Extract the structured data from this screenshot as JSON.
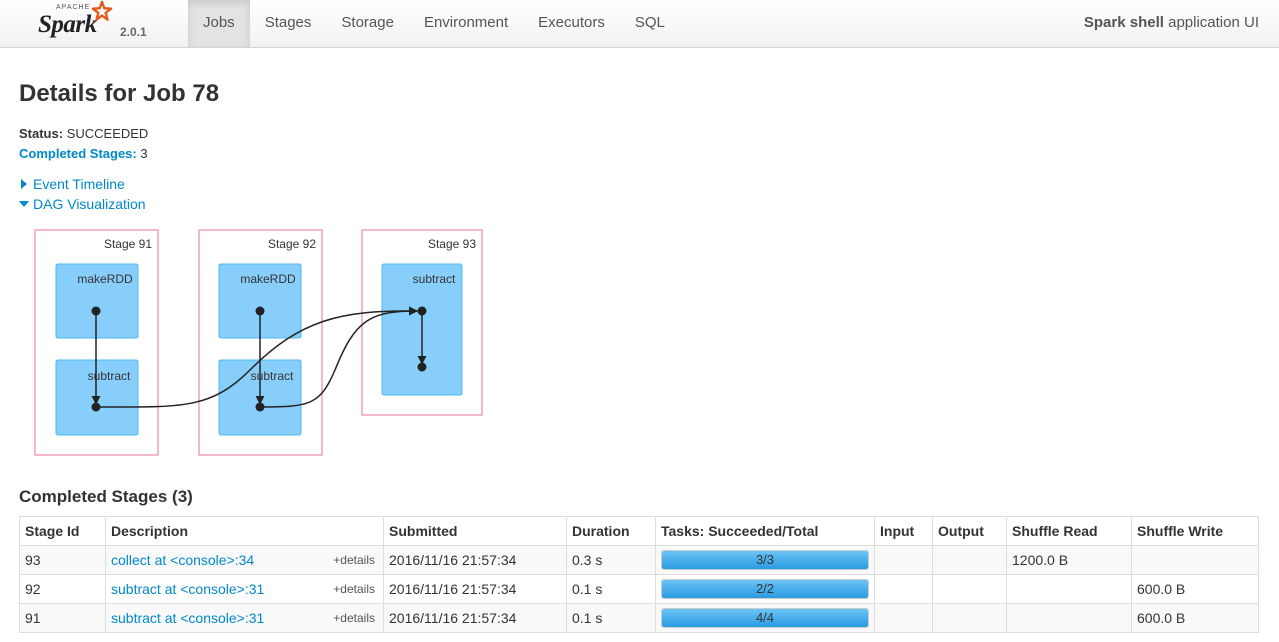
{
  "brand": {
    "apache": "APACHE",
    "name": "Spark",
    "version": "2.0.1"
  },
  "nav": {
    "tabs": [
      {
        "label": "Jobs",
        "active": true
      },
      {
        "label": "Stages",
        "active": false
      },
      {
        "label": "Storage",
        "active": false
      },
      {
        "label": "Environment",
        "active": false
      },
      {
        "label": "Executors",
        "active": false
      },
      {
        "label": "SQL",
        "active": false
      }
    ],
    "app_name": "Spark shell",
    "app_suffix": " application UI"
  },
  "page": {
    "title": "Details for Job 78",
    "status_label": "Status:",
    "status_value": "SUCCEEDED",
    "completed_label": "Completed Stages:",
    "completed_value": "3",
    "event_timeline": "Event Timeline",
    "dag_visualization": "DAG Visualization"
  },
  "dag": {
    "stages": [
      {
        "label": "Stage 91",
        "nodes": [
          "makeRDD",
          "subtract"
        ]
      },
      {
        "label": "Stage 92",
        "nodes": [
          "makeRDD",
          "subtract"
        ]
      },
      {
        "label": "Stage 93",
        "nodes": [
          "subtract"
        ]
      }
    ],
    "colors": {
      "stage_border": "#e8769a",
      "node_fill": "#87cefa",
      "node_border": "#4db8f0",
      "edge": "#222222"
    }
  },
  "completed_stages": {
    "title": "Completed Stages (3)",
    "columns": [
      "Stage Id",
      "Description",
      "Submitted",
      "Duration",
      "Tasks: Succeeded/Total",
      "Input",
      "Output",
      "Shuffle Read",
      "Shuffle Write"
    ],
    "details_label": "+details",
    "rows": [
      {
        "id": "93",
        "description": "collect at <console>:34",
        "submitted": "2016/11/16 21:57:34",
        "duration": "0.3 s",
        "tasks": "3/3",
        "progress": 1.0,
        "input": "",
        "output": "",
        "shuffle_read": "1200.0 B",
        "shuffle_write": ""
      },
      {
        "id": "92",
        "description": "subtract at <console>:31",
        "submitted": "2016/11/16 21:57:34",
        "duration": "0.1 s",
        "tasks": "2/2",
        "progress": 1.0,
        "input": "",
        "output": "",
        "shuffle_read": "",
        "shuffle_write": "600.0 B"
      },
      {
        "id": "91",
        "description": "subtract at <console>:31",
        "submitted": "2016/11/16 21:57:34",
        "duration": "0.1 s",
        "tasks": "4/4",
        "progress": 1.0,
        "input": "",
        "output": "",
        "shuffle_read": "",
        "shuffle_write": "600.0 B"
      }
    ]
  }
}
